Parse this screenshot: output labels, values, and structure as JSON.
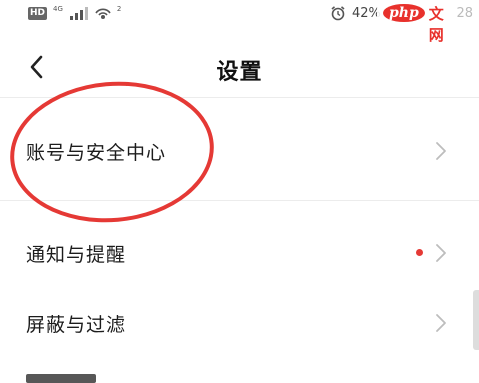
{
  "status_bar": {
    "hd": "HD",
    "network": "4G",
    "hotspot": "2",
    "battery_pct": "42%",
    "battery_level": 0.42,
    "time_partial": "28"
  },
  "watermark": {
    "php": "php",
    "cn": "中文网"
  },
  "header": {
    "title": "设置"
  },
  "settings": {
    "items": [
      {
        "label": "账号与安全中心",
        "badge": false
      },
      {
        "label": "通知与提醒",
        "badge": true
      },
      {
        "label": "屏蔽与过滤",
        "badge": false
      }
    ]
  },
  "colors": {
    "accent_red": "#e53935",
    "divider": "#ececec"
  }
}
